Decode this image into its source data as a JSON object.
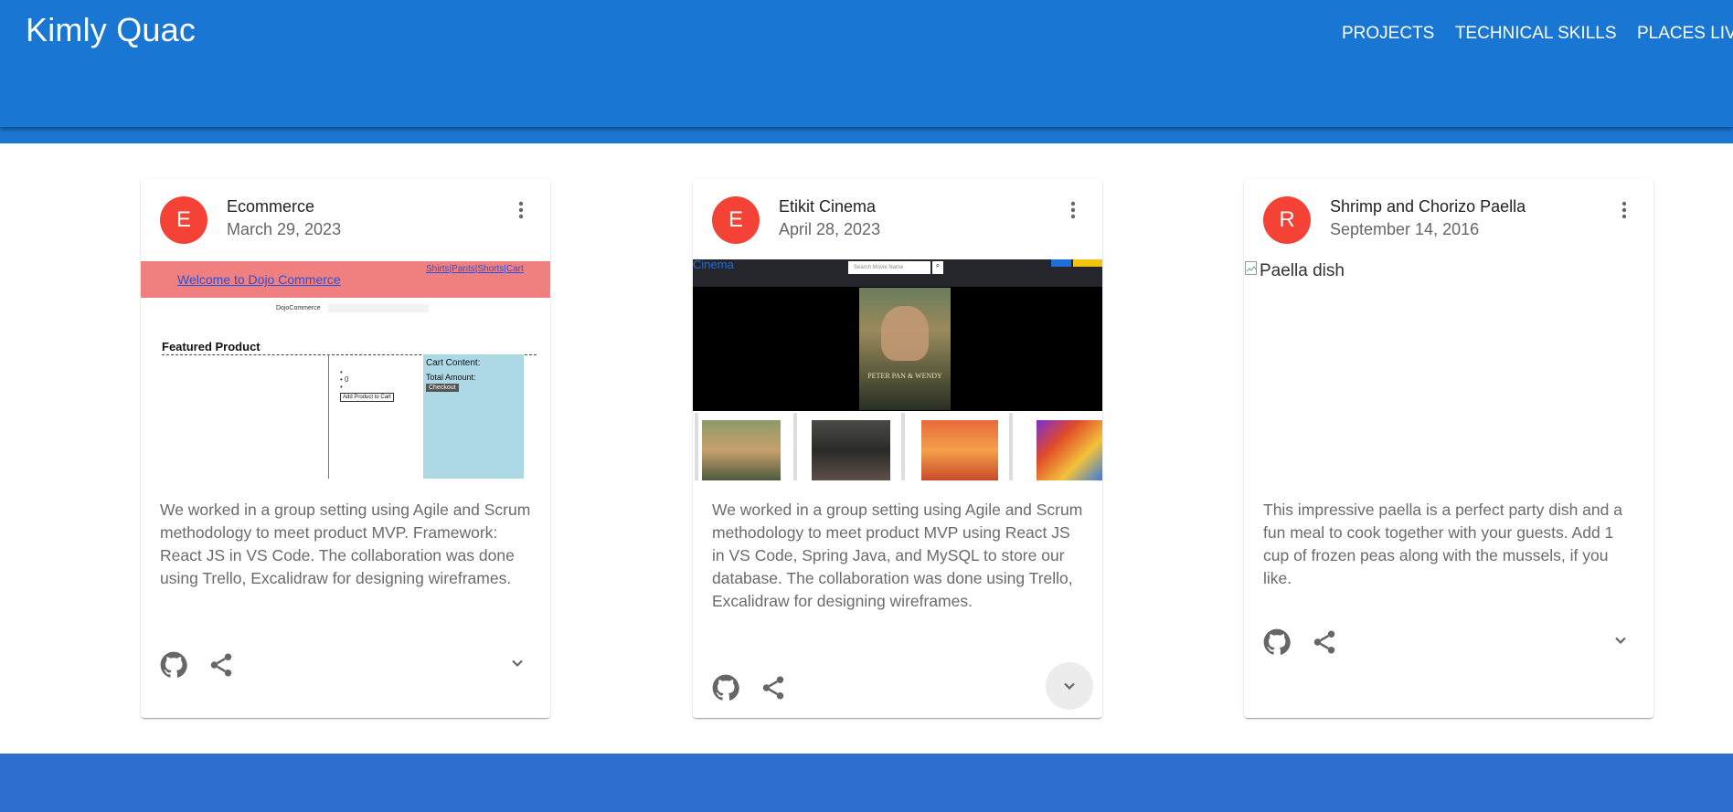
{
  "app": {
    "title": "Kimly Quac",
    "nav": [
      "PROJECTS",
      "TECHNICAL SKILLS",
      "PLACES LIV"
    ]
  },
  "cards": [
    {
      "avatar": "E",
      "title": "Ecommerce",
      "date": "March 29, 2023",
      "description": "We worked in a group setting using Agile and Scrum methodology to meet product MVP. Framework: React JS in VS Code. The collaboration was done using Trello, Excalidraw for designing wireframes.",
      "screenshot": {
        "welcome": "Welcome to Dojo Commerce",
        "links": [
          "Shirts",
          "Pants",
          "Shorts",
          "Cart"
        ],
        "brand": "DojoCommerce",
        "featured": "Featured Product",
        "cart_content": "Cart Content:",
        "total": "Total Amount:",
        "checkout": "Checkout",
        "add": "Add Product to Cart"
      }
    },
    {
      "avatar": "E",
      "title": "Etikit Cinema",
      "date": "April 28, 2023",
      "description": "We worked in a group setting using Agile and Scrum methodology to meet product MVP using React JS in VS Code, Spring Java, and MySQL to store our database. The collaboration was done using Trello, Excalidraw for designing wireframes.",
      "screenshot": {
        "logo": "Cinema",
        "search_placeholder": "Search Movie Name",
        "poster_text": "PETER PAN & WENDY"
      }
    },
    {
      "avatar": "R",
      "title": "Shrimp and Chorizo Paella",
      "date": "September 14, 2016",
      "image_alt": "Paella dish",
      "description": "This impressive paella is a perfect party dish and a fun meal to cook together with your guests. Add 1 cup of frozen peas along with the mussels, if you like."
    }
  ],
  "colors": {
    "primary": "#1976d2",
    "avatar": "#f44336",
    "footer": "#2d6ecf"
  },
  "icons": [
    "more-vert-icon",
    "github-icon",
    "share-icon",
    "expand-more-icon"
  ]
}
